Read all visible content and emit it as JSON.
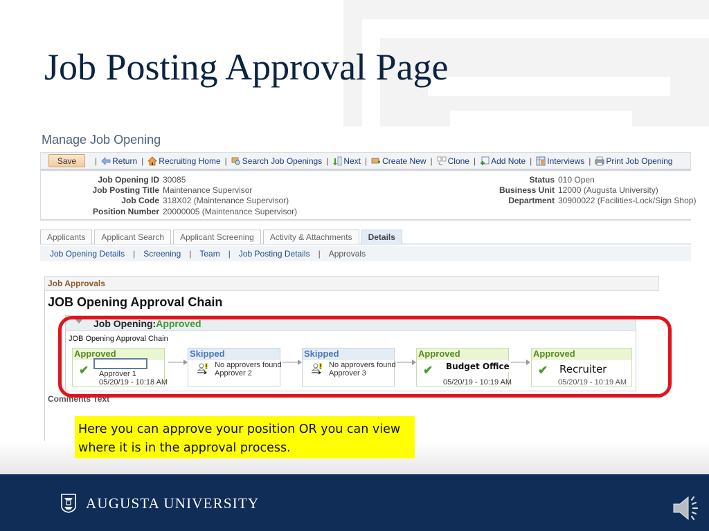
{
  "slide": {
    "title": "Job Posting Approval Page",
    "note": "Here you can approve your position OR you can view where it is in the approval process.",
    "footer_brand": "AUGUSTA UNIVERSITY"
  },
  "page": {
    "title": "Manage Job Opening",
    "toolbar": {
      "save_label": "Save",
      "links": [
        {
          "label": "Return",
          "icon": "return-arrow-icon"
        },
        {
          "label": "Recruiting Home",
          "icon": "home-icon"
        },
        {
          "label": "Search Job Openings",
          "icon": "search-icon"
        },
        {
          "label": "Next",
          "icon": "next-icon"
        },
        {
          "label": "Create New",
          "icon": "create-new-icon"
        },
        {
          "label": "Clone",
          "icon": "clone-icon"
        },
        {
          "label": "Add Note",
          "icon": "add-note-icon"
        },
        {
          "label": "Interviews",
          "icon": "interviews-icon"
        },
        {
          "label": "Print Job Opening",
          "icon": "print-icon"
        }
      ]
    },
    "details_left": [
      {
        "label": "Job Opening ID",
        "value": "30085"
      },
      {
        "label": "Job Posting Title",
        "value": "Maintenance Supervisor"
      },
      {
        "label": "Job Code",
        "value": "318X02 (Maintenance Supervisor)"
      },
      {
        "label": "Position Number",
        "value": "20000005 (Maintenance Supervisor)"
      }
    ],
    "details_right": [
      {
        "label": "Status",
        "value": "010 Open"
      },
      {
        "label": "Business Unit",
        "value": "12000 (Augusta University)"
      },
      {
        "label": "Department",
        "value": "30900022 (Facilities-Lock/Sign Shop)"
      }
    ],
    "tabs": [
      {
        "label": "Applicants",
        "active": false
      },
      {
        "label": "Applicant Search",
        "active": false
      },
      {
        "label": "Applicant Screening",
        "active": false
      },
      {
        "label": "Activity & Attachments",
        "active": false
      },
      {
        "label": "Details",
        "active": true
      }
    ],
    "subnav": [
      {
        "label": "Job Opening Details"
      },
      {
        "label": "Screening"
      },
      {
        "label": "Team"
      },
      {
        "label": "Job Posting Details"
      },
      {
        "label": "Approvals",
        "current": true
      }
    ],
    "approvals": {
      "section_label": "Job Approvals",
      "chain_title": "JOB Opening Approval Chain",
      "header_prefix": "Job Opening:",
      "header_status": "Approved",
      "sub_label": "JOB Opening Approval Chain",
      "steps": [
        {
          "status": "Approved",
          "line1": "",
          "line2": "Approver 1",
          "line3": "05/20/19 - 10:18 AM"
        },
        {
          "status": "Skipped",
          "line1": "No approvers found",
          "line2": "Approver 2"
        },
        {
          "status": "Skipped",
          "line1": "No approvers found",
          "line2": "Approver 3"
        },
        {
          "status": "Approved",
          "overlay": "Budget Office",
          "line3": "05/20/19 - 10:19 AM"
        },
        {
          "status": "Approved",
          "overlay": "Recruiter",
          "line3": "05/20/19 - 10:19 AM"
        }
      ],
      "comments_label": "Comments Text"
    }
  },
  "colors": {
    "footer_bg": "#0f2d57",
    "title_color": "#0b2340",
    "highlight_outline": "#e3131b",
    "note_bg": "#ffff00",
    "approved_green": "#3c9a2b",
    "skipped_blue": "#4a79b8"
  }
}
